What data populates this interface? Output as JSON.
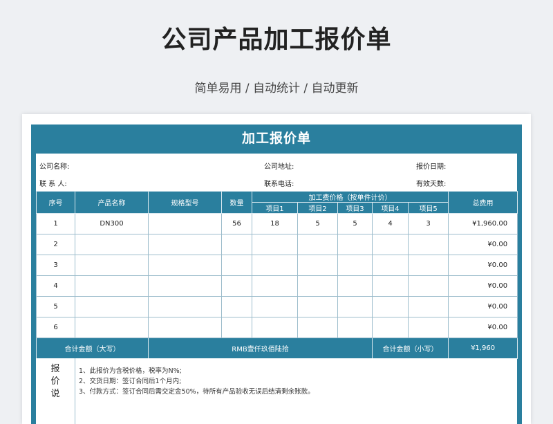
{
  "hero": {
    "title": "公司产品加工报价单",
    "subtitle": "简单易用 / 自动统计 / 自动更新"
  },
  "sheet": {
    "title": "加工报价单",
    "info": {
      "company_name": "公司名称:",
      "company_address": "公司地址:",
      "quote_date": "报价日期:",
      "contact": "联 系 人:",
      "phone": "联系电话:",
      "valid_days": "有效天数:"
    },
    "headers": {
      "index": "序号",
      "product_name": "产品名称",
      "spec": "规格型号",
      "quantity": "数量",
      "fee_group": "加工费价格（按单件计价）",
      "items": [
        "项目1",
        "项目2",
        "项目3",
        "项目4",
        "项目5"
      ],
      "total": "总费用"
    },
    "rows": [
      {
        "index": "1",
        "name": "DN300",
        "spec": "",
        "qty": "56",
        "i1": "18",
        "i2": "5",
        "i3": "5",
        "i4": "4",
        "i5": "3",
        "total": "¥1,960.00"
      },
      {
        "index": "2",
        "name": "",
        "spec": "",
        "qty": "",
        "i1": "",
        "i2": "",
        "i3": "",
        "i4": "",
        "i5": "",
        "total": "¥0.00"
      },
      {
        "index": "3",
        "name": "",
        "spec": "",
        "qty": "",
        "i1": "",
        "i2": "",
        "i3": "",
        "i4": "",
        "i5": "",
        "total": "¥0.00"
      },
      {
        "index": "4",
        "name": "",
        "spec": "",
        "qty": "",
        "i1": "",
        "i2": "",
        "i3": "",
        "i4": "",
        "i5": "",
        "total": "¥0.00"
      },
      {
        "index": "5",
        "name": "",
        "spec": "",
        "qty": "",
        "i1": "",
        "i2": "",
        "i3": "",
        "i4": "",
        "i5": "",
        "total": "¥0.00"
      },
      {
        "index": "6",
        "name": "",
        "spec": "",
        "qty": "",
        "i1": "",
        "i2": "",
        "i3": "",
        "i4": "",
        "i5": "",
        "total": "¥0.00"
      }
    ],
    "totals": {
      "upper_label": "合计金额（大写）",
      "upper_value": "RMB壹仟玖佰陆拾",
      "lower_label": "合计金额（小写）",
      "lower_value": "¥1,960"
    },
    "notes": {
      "label": [
        "报",
        "价",
        "说"
      ],
      "lines": [
        "1、此报价为含税价格，税率为N%;",
        "2、交货日期：签订合同后1个月内;",
        "3、付款方式：签订合同后需交定金50%，待所有产品验收无误后结清剩余账款。"
      ]
    }
  }
}
